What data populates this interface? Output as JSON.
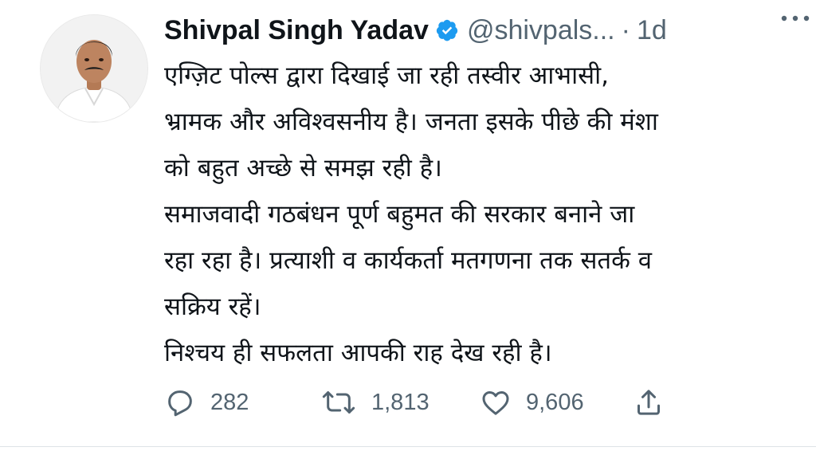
{
  "tweet": {
    "author_name": "Shivpal Singh Yadav",
    "handle": "@shivpals...",
    "separator": "·",
    "time": "1d",
    "verified_icon": "verified-badge-icon",
    "more_icon": "more-horizontal-icon",
    "text_lines": [
      "एग्ज़िट पोल्स द्वारा दिखाई जा रही तस्वीर आभासी,",
      "भ्रामक और अविश्वसनीय है। जनता इसके पीछे की मंशा",
      "को बहुत अच्छे से समझ रही है।",
      "समाजवादी गठबंधन पूर्ण बहुमत की सरकार बनाने जा",
      "रहा रहा है। प्रत्याशी व कार्यकर्ता मतगणना तक सतर्क व",
      "सक्रिय रहें।",
      "निश्चय ही सफलता आपकी राह देख रही है।"
    ],
    "stats": {
      "replies": "282",
      "retweets": "1,813",
      "likes": "9,606"
    }
  },
  "colors": {
    "text": "#0f1419",
    "secondary": "#536471",
    "verified": "#1d9bf0",
    "divider": "#dde3e7"
  }
}
